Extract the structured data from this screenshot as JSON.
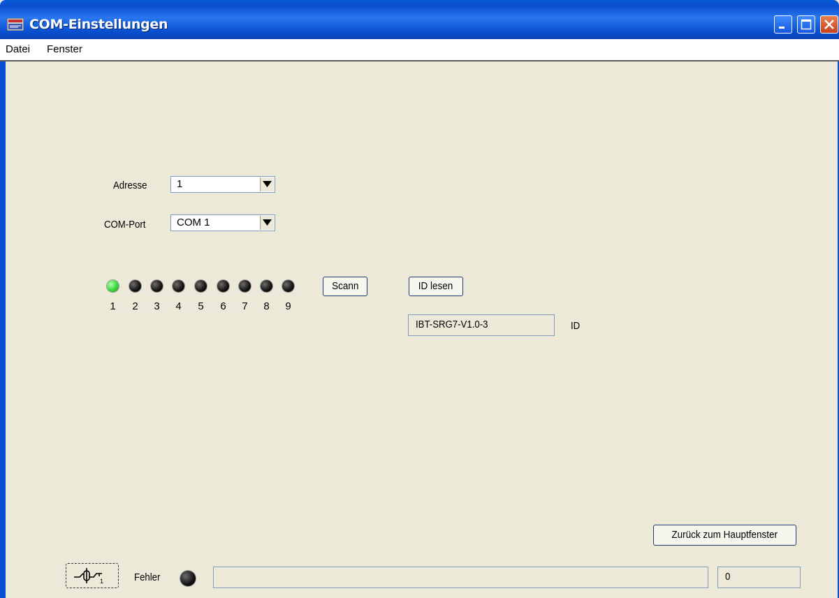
{
  "window": {
    "title": "COM-Einstellungen"
  },
  "menu": {
    "items": [
      "Datei",
      "Fenster"
    ]
  },
  "form": {
    "address_label": "Adresse",
    "address_value": "1",
    "comport_label": "COM-Port",
    "comport_value": "COM 1"
  },
  "leds": {
    "labels": [
      "1",
      "2",
      "3",
      "4",
      "5",
      "6",
      "7",
      "8",
      "9"
    ],
    "active_index": 1
  },
  "buttons": {
    "scan": "Scann",
    "read_id": "ID lesen",
    "back": "Zurück zum Hauptfenster"
  },
  "id_section": {
    "value": "IBT-SRG7-V1.0-3",
    "label": "ID"
  },
  "status": {
    "error_label": "Fehler",
    "counter": "0",
    "message": ""
  },
  "colors": {
    "led_on": "#39d63a",
    "led_off": "#111111",
    "titlebar": "#0a50d2"
  }
}
